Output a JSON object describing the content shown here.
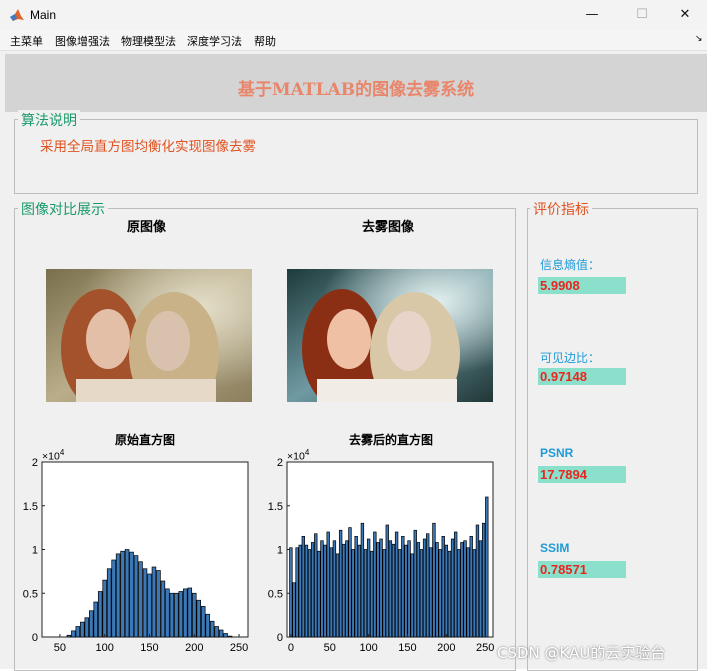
{
  "window": {
    "title": "Main",
    "minimize_glyph": "—",
    "maximize_glyph": "☐",
    "close_glyph": "✕"
  },
  "menu": [
    "主菜单",
    "图像增强法",
    "物理模型法",
    "深度学习法",
    "帮助"
  ],
  "menu_arrow_glyph": "↘",
  "banner": {
    "title": "基于MATLAB的图像去雾系统"
  },
  "algo_panel": {
    "legend": "算法说明",
    "description": "采用全局直方图均衡化实现图像去雾"
  },
  "compare_panel": {
    "legend": "图像对比展示",
    "original_label": "原图像",
    "dehazed_label": "去雾图像"
  },
  "metrics_panel": {
    "legend": "评价指标",
    "items": [
      {
        "label": "信息熵值：",
        "value": "5.9908"
      },
      {
        "label": "可见边比：",
        "value": "0.97148"
      },
      {
        "label": "PSNR",
        "value": "17.7894"
      },
      {
        "label": "SSIM",
        "value": "0.78571"
      }
    ]
  },
  "watermark": "CSDN @KAU的云实验台",
  "chart_data": [
    {
      "type": "bar",
      "title": "原始直方图",
      "exponent_label": "×10",
      "exponent_power": "4",
      "xlim": [
        30,
        260
      ],
      "ylim": [
        0,
        2
      ],
      "xticks": [
        50,
        100,
        150,
        200,
        250
      ],
      "yticks": [
        "0",
        "0.5",
        "1",
        "1.5",
        "2"
      ],
      "x": [
        45,
        50,
        55,
        60,
        65,
        70,
        75,
        80,
        85,
        90,
        95,
        100,
        105,
        110,
        115,
        120,
        125,
        130,
        135,
        140,
        145,
        150,
        155,
        160,
        165,
        170,
        175,
        180,
        185,
        190,
        195,
        200,
        205,
        210,
        215,
        220,
        225,
        230,
        235,
        240
      ],
      "values": [
        0,
        0,
        0,
        0.02,
        0.07,
        0.12,
        0.17,
        0.22,
        0.3,
        0.4,
        0.52,
        0.65,
        0.78,
        0.88,
        0.95,
        0.98,
        1.0,
        0.97,
        0.93,
        0.86,
        0.78,
        0.72,
        0.8,
        0.76,
        0.64,
        0.55,
        0.5,
        0.5,
        0.52,
        0.55,
        0.56,
        0.5,
        0.42,
        0.35,
        0.26,
        0.18,
        0.12,
        0.08,
        0.04,
        0.01
      ]
    },
    {
      "type": "bar",
      "title": "去雾后的直方图",
      "exponent_label": "×10",
      "exponent_power": "4",
      "xlim": [
        -5,
        260
      ],
      "ylim": [
        0,
        2
      ],
      "xticks": [
        0,
        50,
        100,
        150,
        200,
        250
      ],
      "yticks": [
        "0",
        "0.5",
        "1",
        "1.5",
        "2"
      ],
      "x": [
        0,
        4,
        8,
        12,
        16,
        20,
        24,
        28,
        32,
        36,
        40,
        44,
        48,
        52,
        56,
        60,
        64,
        68,
        72,
        76,
        80,
        84,
        88,
        92,
        96,
        100,
        104,
        108,
        112,
        116,
        120,
        124,
        128,
        132,
        136,
        140,
        144,
        148,
        152,
        156,
        160,
        164,
        168,
        172,
        176,
        180,
        184,
        188,
        192,
        196,
        200,
        204,
        208,
        212,
        216,
        220,
        224,
        228,
        232,
        236,
        240,
        244,
        248,
        252
      ],
      "values": [
        1.02,
        0.62,
        1.02,
        1.05,
        1.15,
        1.05,
        1.0,
        1.08,
        1.18,
        0.98,
        1.1,
        1.05,
        1.2,
        1.02,
        1.1,
        0.95,
        1.22,
        1.06,
        1.1,
        1.25,
        1.0,
        1.15,
        1.05,
        1.3,
        1.0,
        1.12,
        0.98,
        1.2,
        1.08,
        1.12,
        1.0,
        1.28,
        1.1,
        1.06,
        1.2,
        1.0,
        1.15,
        1.05,
        1.1,
        0.95,
        1.22,
        1.08,
        1.0,
        1.12,
        1.18,
        1.02,
        1.3,
        1.08,
        1.0,
        1.15,
        1.05,
        0.98,
        1.12,
        1.2,
        1.0,
        1.08,
        1.1,
        1.02,
        1.15,
        1.0,
        1.28,
        1.1,
        1.3,
        1.6
      ]
    }
  ]
}
